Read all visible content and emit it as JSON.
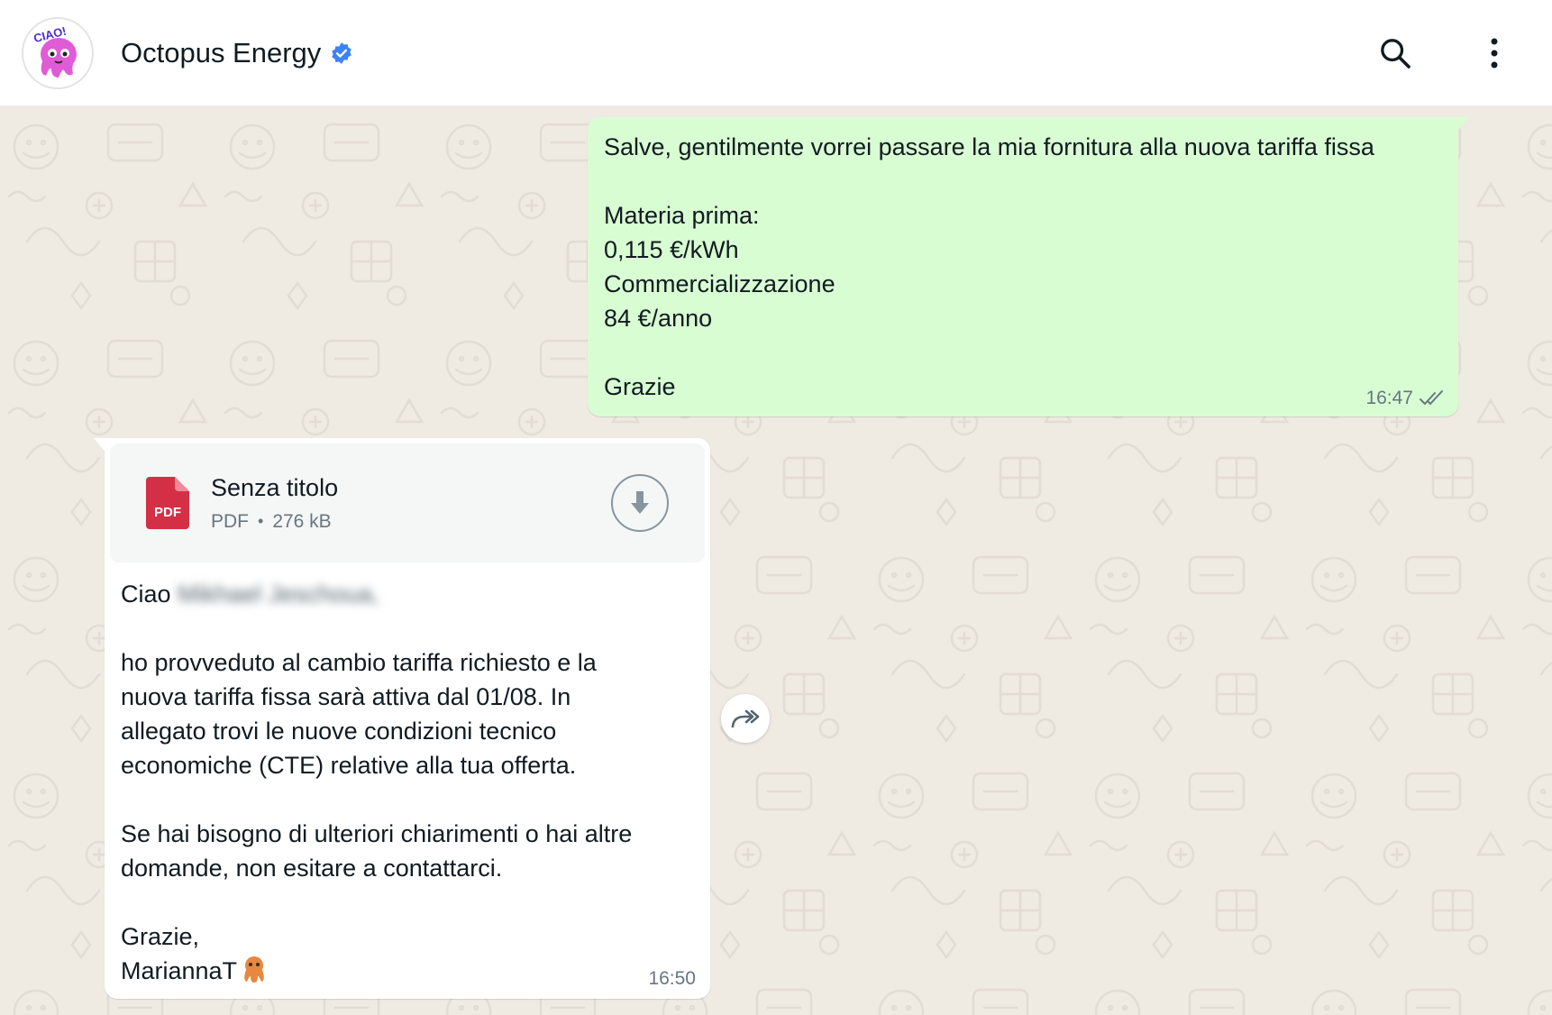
{
  "header": {
    "contact_name": "Octopus Energy",
    "avatar_text": "CIAO!",
    "icons": [
      "search-icon",
      "menu-dots-icon",
      "verified-badge-icon"
    ]
  },
  "outgoing": {
    "text": "Salve, gentilmente vorrei passare la mia fornitura alla nuova tariffa fissa\n\nMateria prima:\n0,115 €/kWh\nCommercializzazione\n84 €/anno\n\nGrazie",
    "time": "16:47",
    "status": "read"
  },
  "incoming": {
    "document": {
      "title": "Senza titolo",
      "type": "PDF",
      "separator": "•",
      "size": "276 kB",
      "icon_label": "PDF"
    },
    "greeting": "Ciao",
    "blurred_name": "Mikhael Jeschoua,",
    "body": "ho provveduto al cambio tariffa richiesto e la\nnuova tariffa fissa sarà attiva dal 01/08. In\nallegato trovi le nuove condizioni tecnico\neconomiche (CTE) relative alla tua offerta.\n\nSe hai bisogno di ulteriori chiarimenti o hai altre\ndomande, non esitare a contattarci.\n\nGrazie,",
    "signature": "MariannaT",
    "time": "16:50"
  },
  "colors": {
    "outgoing_bubble": "#d9fdd3",
    "incoming_bubble": "#ffffff",
    "chat_background": "#efeae2",
    "verified_blue": "#3b82f6",
    "pdf_red": "#d32f45"
  }
}
